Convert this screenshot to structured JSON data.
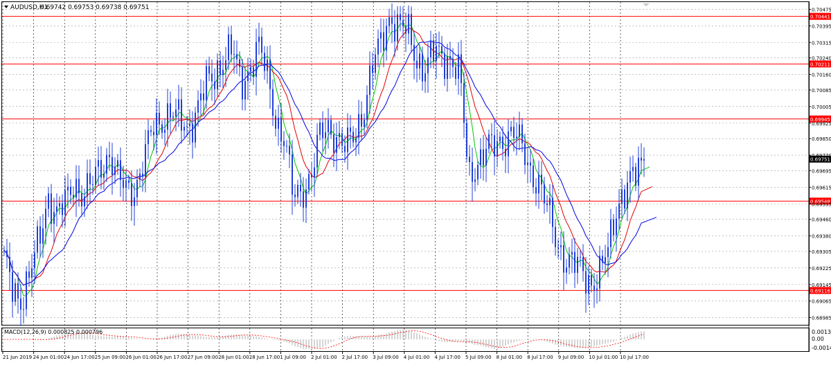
{
  "header": {
    "symbol": "AUDUSD,H1",
    "ohlc": "0.69742 0.69753 0.69738 0.69751"
  },
  "macd": {
    "label": "MACD(12,26,9) 0.000825 0.000796",
    "ticks": [
      "0.00131",
      "0.00",
      "-0.00147"
    ]
  },
  "chart_data": {
    "type": "candlestick",
    "instrument": "AUDUSD",
    "timeframe": "H1",
    "price_ticks": [
      "0.70475",
      "0.70395",
      "0.70315",
      "0.70240",
      "0.70160",
      "0.70085",
      "0.70005",
      "0.69925",
      "0.69850",
      "0.69770",
      "0.69695",
      "0.69615",
      "0.69535",
      "0.69460",
      "0.69380",
      "0.69305",
      "0.69225",
      "0.69145",
      "0.69065",
      "0.68985"
    ],
    "time_ticks": [
      "21 Jun 2019",
      "24 Jun 01:00",
      "24 Jun 17:00",
      "25 Jun 09:00",
      "26 Jun 01:00",
      "26 Jun 17:00",
      "27 Jun 09:00",
      "28 Jun 01:00",
      "28 Jun 17:00",
      "1 Jul 09:00",
      "2 Jul 01:00",
      "2 Jul 17:00",
      "3 Jul 09:00",
      "4 Jul 01:00",
      "4 Jul 17:00",
      "5 Jul 09:00",
      "8 Jul 01:00",
      "8 Jul 17:00",
      "9 Jul 09:00",
      "10 Jul 01:00",
      "10 Jul 17:00"
    ],
    "ylim": [
      0.6895,
      0.7051
    ],
    "horizontal_levels": [
      {
        "price": 0.70441,
        "label": "0.70441"
      },
      {
        "price": 0.70211,
        "label": "0.70211"
      },
      {
        "price": 0.69945,
        "label": "0.69945"
      },
      {
        "price": 0.69548,
        "label": "0.69548"
      },
      {
        "price": 0.69116,
        "label": "0.69116"
      }
    ],
    "current_price": {
      "price": 0.69751,
      "label": "0.69751"
    },
    "price_series": {
      "name": "AUDUSD",
      "values": [
        0.6925,
        0.6912,
        0.6908,
        0.692,
        0.6935,
        0.6958,
        0.6948,
        0.6953,
        0.6965,
        0.6958,
        0.6962,
        0.6972,
        0.6978,
        0.6965,
        0.696,
        0.6962,
        0.6975,
        0.699,
        0.6995,
        0.6998,
        0.6993,
        0.699,
        0.7,
        0.701,
        0.7015,
        0.7025,
        0.7028,
        0.701,
        0.702,
        0.703,
        0.7015,
        0.6995,
        0.6985,
        0.6955,
        0.696,
        0.6968,
        0.6985,
        0.699,
        0.6987,
        0.698,
        0.6986,
        0.7,
        0.702,
        0.703,
        0.7045,
        0.704,
        0.7036,
        0.7024,
        0.702,
        0.7026,
        0.7024,
        0.7025,
        0.7015,
        0.6965,
        0.6975,
        0.698,
        0.698,
        0.6985,
        0.699,
        0.698,
        0.697,
        0.6965,
        0.695,
        0.6935,
        0.6928,
        0.6924,
        0.692,
        0.6916,
        0.692,
        0.6932,
        0.6955,
        0.6962,
        0.6966,
        0.6975
      ]
    },
    "moving_averages": [
      {
        "color": "#00c800"
      },
      {
        "color": "#e00000"
      },
      {
        "color": "#0000e0"
      }
    ],
    "colors": {
      "candles": "#1f3fd8",
      "levels": "#ff0000",
      "grid": "#9a9a9a",
      "macd_hist": "#b8b8b8",
      "macd_signal": "#ff0000",
      "axis_text": "#000000"
    }
  }
}
